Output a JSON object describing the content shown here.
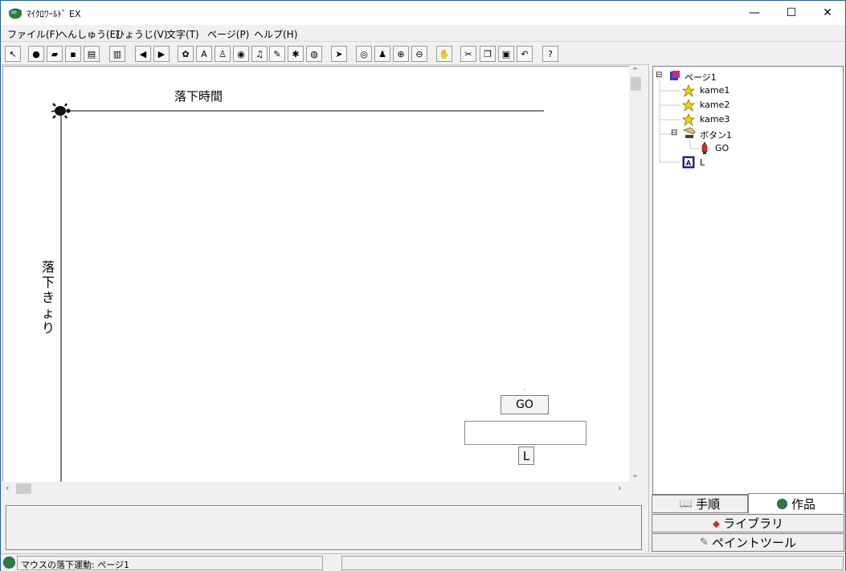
{
  "window": {
    "title": "ﾏｲｸﾛﾜｰﾙﾄﾞ EX",
    "controls": {
      "minimize": "—",
      "maximize": "☐",
      "close": "✕"
    }
  },
  "menu": [
    "ファイル(F)",
    "へんしゅう(E)",
    "ひょうじ(V)",
    "文字(T)",
    "ページ(P)",
    "ヘルプ(H)"
  ],
  "toolbar": {
    "buttons": [
      {
        "name": "select-arrow-icon",
        "glyph": "↖"
      },
      {
        "name": "globe-icon",
        "glyph": "●"
      },
      {
        "name": "open-folder-icon",
        "glyph": "▰"
      },
      {
        "name": "save-icon",
        "glyph": "▪"
      },
      {
        "name": "print-icon",
        "glyph": "▤"
      },
      {
        "name": "page-layout-icon",
        "glyph": "▥"
      },
      {
        "name": "back-arrow-icon",
        "glyph": "◀"
      },
      {
        "name": "forward-arrow-icon",
        "glyph": "▶"
      },
      {
        "name": "turtle-icon",
        "glyph": "✿"
      },
      {
        "name": "text-box-icon",
        "glyph": "A"
      },
      {
        "name": "button-tool-icon",
        "glyph": "♙"
      },
      {
        "name": "field-tool-icon",
        "glyph": "◉"
      },
      {
        "name": "music-icon",
        "glyph": "♫"
      },
      {
        "name": "pen-icon",
        "glyph": "✎"
      },
      {
        "name": "movie-icon",
        "glyph": "✱"
      },
      {
        "name": "sphere-icon",
        "glyph": "◍"
      },
      {
        "name": "pointer-icon",
        "glyph": "➤"
      },
      {
        "name": "eye-icon",
        "glyph": "◎"
      },
      {
        "name": "stamp-icon",
        "glyph": "♟"
      },
      {
        "name": "zoom-in-icon",
        "glyph": "⊕"
      },
      {
        "name": "zoom-out-icon",
        "glyph": "⊖"
      },
      {
        "name": "stop-hand-icon",
        "glyph": "✋"
      },
      {
        "name": "scissors-icon",
        "glyph": "✂"
      },
      {
        "name": "copy-icon",
        "glyph": "❐"
      },
      {
        "name": "paste-icon",
        "glyph": "▣"
      },
      {
        "name": "undo-icon",
        "glyph": "↶"
      },
      {
        "name": "help-icon",
        "glyph": "?"
      }
    ]
  },
  "canvas": {
    "label_time": "落下時間",
    "label_distance_chars": [
      "落",
      "下",
      "き",
      "ょ",
      "り"
    ],
    "go_button": "GO",
    "output_field_value": "",
    "text_L": "L"
  },
  "tree": {
    "items": [
      {
        "label": "ページ1",
        "icon": "page-icon",
        "expander": "⊟"
      },
      {
        "label": "kame1",
        "icon": "turtle-icon"
      },
      {
        "label": "kame2",
        "icon": "turtle-icon"
      },
      {
        "label": "kame3",
        "icon": "turtle-icon"
      },
      {
        "label": "ボタン1",
        "icon": "button-icon",
        "expander": "⊟"
      },
      {
        "label": "GO",
        "icon": "rocket-icon"
      },
      {
        "label": "L",
        "icon": "text-a-icon"
      }
    ]
  },
  "tabs": {
    "procedure": "手順",
    "works": "作品",
    "library": "ライブラリ",
    "paint_tool": "ペイントツール"
  },
  "status": {
    "text": "マウスの落下運動: ページ1"
  },
  "colors": {
    "title_border": "#1e5fa8",
    "turtle": "#111111",
    "tree_turtle": "#f5d400"
  }
}
